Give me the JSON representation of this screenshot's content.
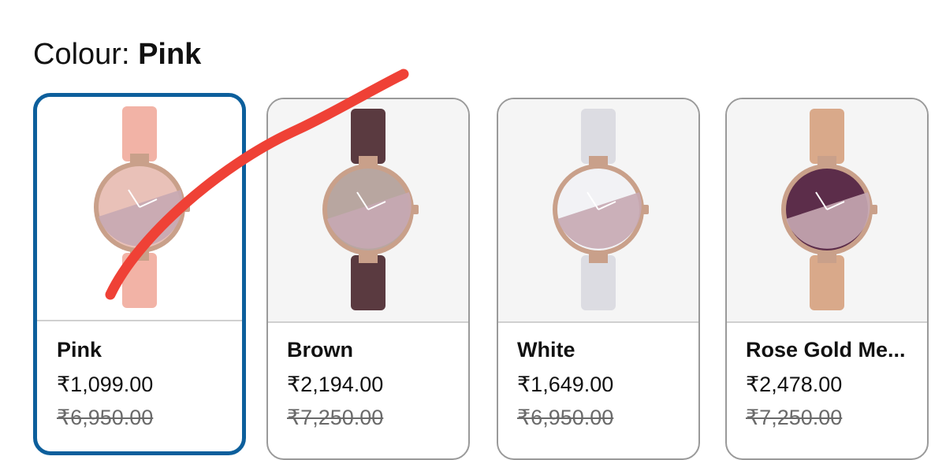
{
  "colour": {
    "label": "Colour:",
    "value": "Pink"
  },
  "variants": [
    {
      "name": "Pink",
      "price": "₹1,099.00",
      "mrp": "₹6,950.00",
      "selected": true,
      "strap_color": "#f2b3a6",
      "dial_color": "#e9c1b8"
    },
    {
      "name": "Brown",
      "price": "₹2,194.00",
      "mrp": "₹7,250.00",
      "selected": false,
      "strap_color": "#5a3a40",
      "dial_color": "#b8a6a0"
    },
    {
      "name": "White",
      "price": "₹1,649.00",
      "mrp": "₹6,950.00",
      "selected": false,
      "strap_color": "#dcdce2",
      "dial_color": "#f2f2f5"
    },
    {
      "name": "Rose Gold Me...",
      "price": "₹2,478.00",
      "mrp": "₹7,250.00",
      "selected": false,
      "strap_color": "#d9a98a",
      "dial_color": "#5c2d4a"
    }
  ],
  "colors": {
    "selected_border": "#0d5f9c",
    "annotation_stroke": "#ef4136"
  }
}
